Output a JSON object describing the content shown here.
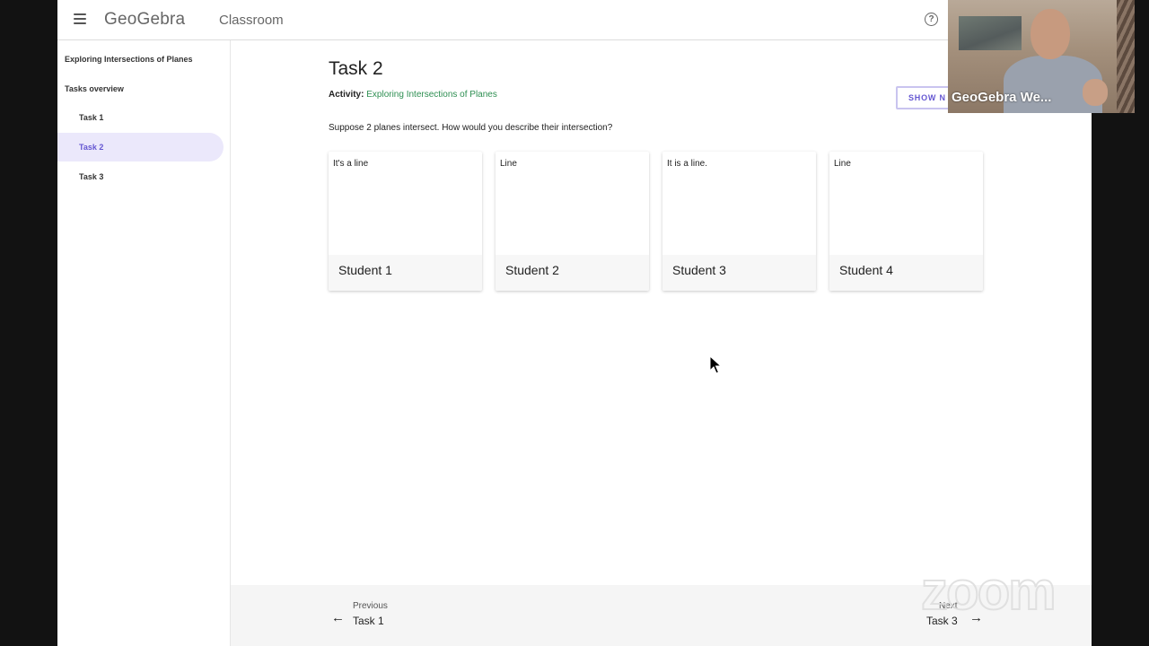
{
  "header": {
    "logo": "GeoGebra",
    "product": "Classroom",
    "help_icon": "help-circle-icon"
  },
  "sidebar": {
    "activity_title": "Exploring Intersections of Planes",
    "overview": "Tasks overview",
    "tasks": [
      {
        "label": "Task 1",
        "active": false
      },
      {
        "label": "Task 2",
        "active": true
      },
      {
        "label": "Task 3",
        "active": false
      }
    ]
  },
  "main": {
    "task_title": "Task 2",
    "activity_label": "Activity:",
    "activity_link": "Exploring Intersections of Planes",
    "show_button": "SHOW N",
    "question": "Suppose 2 planes intersect. How would you describe their intersection?",
    "cards": [
      {
        "answer": "It's a line",
        "student": "Student 1"
      },
      {
        "answer": "Line",
        "student": "Student 2"
      },
      {
        "answer": "It is a line.",
        "student": "Student 3"
      },
      {
        "answer": "Line",
        "student": "Student 4"
      }
    ]
  },
  "nav": {
    "prev_label": "Previous",
    "prev_task": "Task 1",
    "next_label": "Next",
    "next_task": "Task 3"
  },
  "video": {
    "name": "GeoGebra We..."
  },
  "watermark": "zoom",
  "colors": {
    "accent": "#6557d2",
    "active_bg": "#ebe8fb",
    "link": "#2e8f52"
  }
}
